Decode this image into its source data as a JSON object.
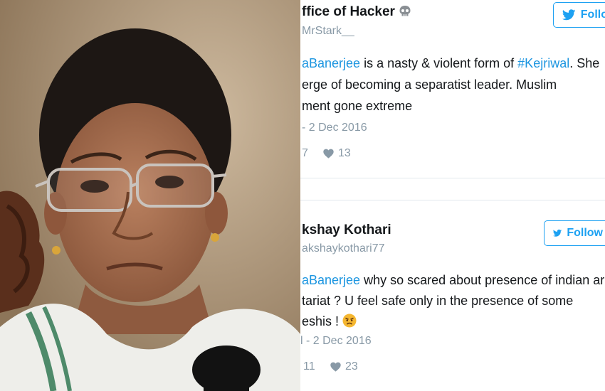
{
  "tweets": [
    {
      "name": "ffice of Hacker",
      "handle": "MrStark__",
      "follow_label": "Follo",
      "line1_mention": "aBanerjee",
      "line1_mid": " is a nasty & violent form of ",
      "line1_tag": "#Kejriwal",
      "line1_end": ". She",
      "line2": "erge of becoming a separatist leader. Muslim",
      "line3": "ment gone extreme",
      "date": "- 2 Dec 2016",
      "retweets": "7",
      "likes": "13"
    },
    {
      "name": "kshay Kothari",
      "handle": "akshaykothari77",
      "follow_label": "Follow",
      "line1_mention": "aBanerjee",
      "line1_rest": " why so scared about presence of indian arm",
      "line2": "tariat ? U feel safe only in the presence of some",
      "line3": "eshis ! ",
      "date": "l - 2 Dec 2016",
      "retweets": "11",
      "likes": "23"
    }
  ],
  "colors": {
    "twitter_blue": "#1da1f2",
    "link_blue": "#1b95e0",
    "text_dark": "#14171a",
    "text_gray": "#8899a6",
    "divider": "#e1e8ed"
  },
  "icons": [
    "skull-icon",
    "twitter-bird-icon",
    "heart-icon",
    "angry-face-icon"
  ]
}
